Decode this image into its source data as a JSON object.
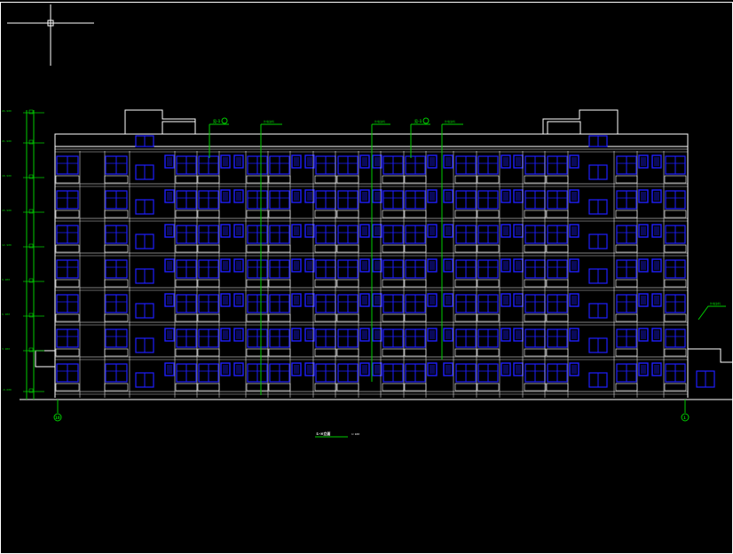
{
  "drawing": {
    "colors": {
      "background": "#000000",
      "outline": "#ffffff",
      "window": "#1e1eff",
      "annotation": "#00cc00"
    },
    "title": "①-⑩立面",
    "scale": "1:100",
    "axis_left": "10",
    "axis_right": "1",
    "floors": 7,
    "levels": [
      "24.900",
      "21.900",
      "18.900",
      "15.900",
      "12.900",
      "9.900",
      "6.900",
      "3.900",
      "-0.600"
    ],
    "callouts": [
      "见-1",
      "见-1"
    ],
    "notes": [
      "外墙涂料",
      "外墙涂料",
      "外墙涂料",
      "外墙涂料"
    ],
    "side_note": "外墙涂料"
  }
}
